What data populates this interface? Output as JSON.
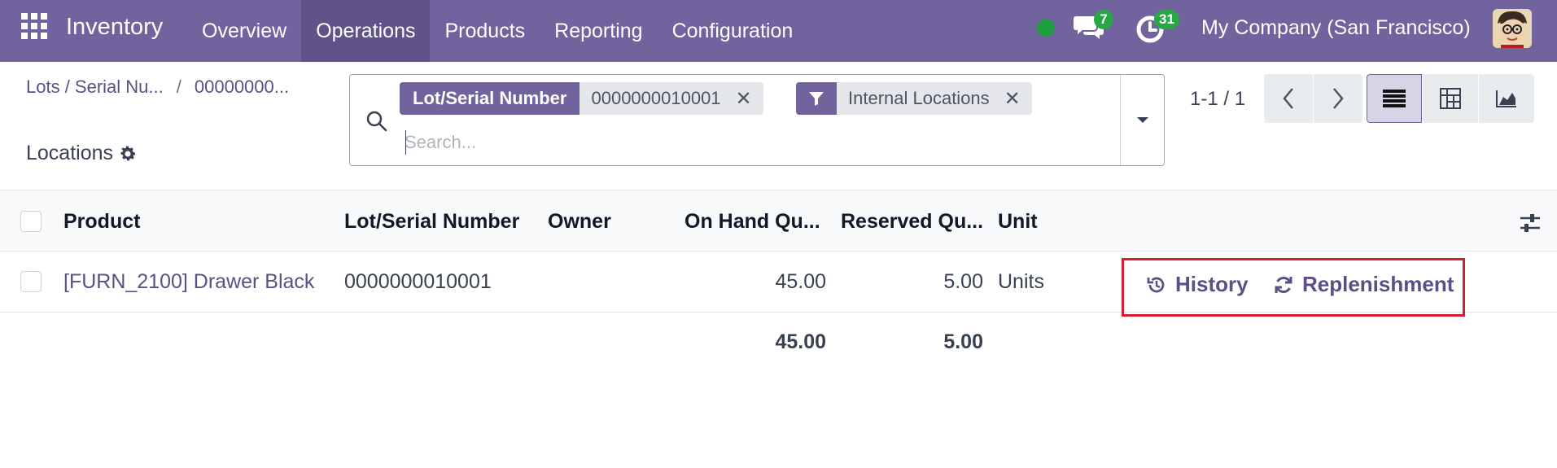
{
  "navbar": {
    "app_title": "Inventory",
    "menu": [
      "Overview",
      "Operations",
      "Products",
      "Reporting",
      "Configuration"
    ],
    "active_menu": "Operations",
    "chat_count": "7",
    "activity_count": "31",
    "company": "My Company (San Francisco)",
    "accent_color": "#71639e",
    "badge_color": "#28a745"
  },
  "breadcrumb": {
    "items": [
      "Lots / Serial Nu...",
      "00000000..."
    ],
    "separator": "/"
  },
  "subtitle": "Locations",
  "search": {
    "facets": [
      {
        "label": "Lot/Serial Number",
        "value": "0000000010001"
      },
      {
        "icon": "filter-icon",
        "value": "Internal Locations"
      }
    ],
    "placeholder": "Search..."
  },
  "pager": {
    "value": "1-1 / 1"
  },
  "list": {
    "headers": {
      "product": "Product",
      "lot": "Lot/Serial Number",
      "owner": "Owner",
      "on_hand": "On Hand Qu...",
      "reserved": "Reserved Qu...",
      "unit": "Unit"
    },
    "rows": [
      {
        "product": "[FURN_2100] Drawer Black",
        "lot": "0000000010001",
        "owner": "",
        "on_hand": "45.00",
        "reserved": "5.00",
        "unit": "Units",
        "actions": {
          "history": "History",
          "replenishment": "Replenishment"
        }
      }
    ],
    "totals": {
      "on_hand": "45.00",
      "reserved": "5.00"
    }
  },
  "highlight_color": "#d11f2c"
}
